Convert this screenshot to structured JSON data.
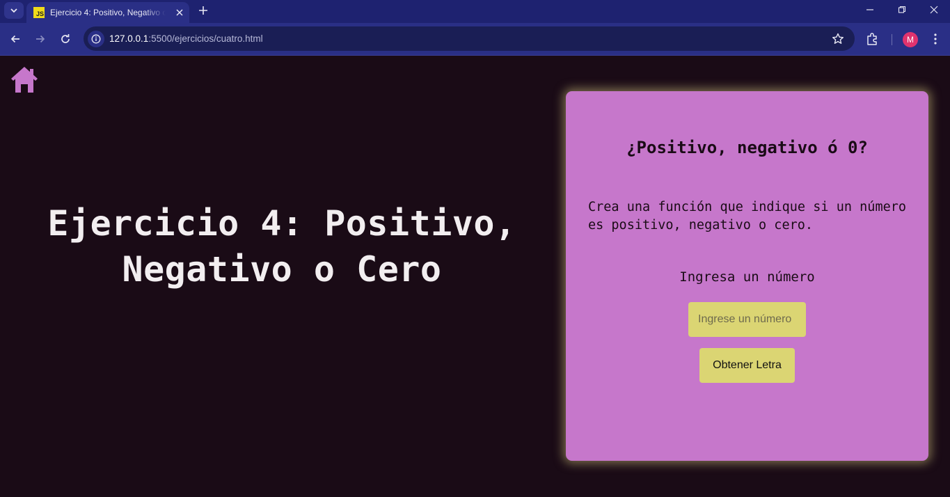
{
  "browser": {
    "tab_title": "Ejercicio 4: Positivo, Negativo o Cero",
    "favicon_text": "JS",
    "url_host": "127.0.0.1",
    "url_path": ":5500/ejercicios/cuatro.html",
    "profile_initial": "M",
    "icons": [
      "tab-search-icon",
      "close-icon",
      "new-tab-icon",
      "minimize-icon",
      "restore-icon",
      "window-close-icon",
      "back-icon",
      "forward-icon",
      "reload-icon",
      "site-info-icon",
      "bookmark-star-icon",
      "extensions-icon",
      "menu-icon"
    ]
  },
  "page": {
    "home_icon": "home-icon",
    "hero_title": "Ejercicio 4: Positivo, Negativo o Cero",
    "card": {
      "title": "¿Positivo, negativo ó 0?",
      "description": "Crea una función que indique si un número es positivo, negativo o cero.",
      "input_label": "Ingresa un número",
      "input_placeholder": "Ingrese un número",
      "input_value": "",
      "button_label": "Obtener Letra"
    }
  },
  "colors": {
    "page_background": "#1a0b16",
    "card_background": "#c677cb",
    "input_background": "#dbd573",
    "home_icon": "#c677cb",
    "tabstrip": "#1e2270",
    "toolbar": "#2a2f86"
  }
}
